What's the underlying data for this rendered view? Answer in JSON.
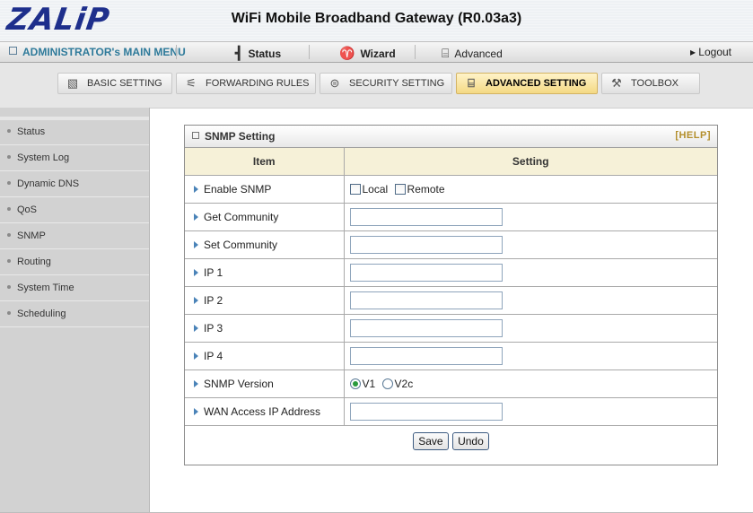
{
  "header": {
    "logo": "ZALiP",
    "title": "WiFi Mobile Broadband Gateway (R0.03a3)"
  },
  "menubar": {
    "admin_label": "ADMINISTRATOR's MAIN MENU",
    "status_label": "Status",
    "wizard_label": "Wizard",
    "advanced_label": "Advanced",
    "logout_label": "▸ Logout",
    "icons": {
      "status": "status-icon",
      "wizard": "wizard-icon",
      "advanced": "advanced-icon"
    }
  },
  "tabs": [
    {
      "label": "BASIC SETTING",
      "icon": "basic-setting-icon"
    },
    {
      "label": "FORWARDING RULES",
      "icon": "forwarding-rules-icon"
    },
    {
      "label": "SECURITY SETTING",
      "icon": "security-setting-icon"
    },
    {
      "label": "ADVANCED SETTING",
      "icon": "advanced-setting-icon",
      "active": true
    },
    {
      "label": "TOOLBOX",
      "icon": "toolbox-icon"
    }
  ],
  "sidebar": {
    "items": [
      {
        "label": "Status"
      },
      {
        "label": "System Log"
      },
      {
        "label": "Dynamic DNS"
      },
      {
        "label": "QoS"
      },
      {
        "label": "SNMP"
      },
      {
        "label": "Routing"
      },
      {
        "label": "System Time"
      },
      {
        "label": "Scheduling"
      }
    ]
  },
  "panel": {
    "title": "SNMP Setting",
    "help": "[HELP]",
    "col_item": "Item",
    "col_setting": "Setting",
    "rows": {
      "enable_snmp": {
        "label": "Enable SNMP",
        "local": "Local",
        "remote": "Remote",
        "local_checked": false,
        "remote_checked": false
      },
      "get_community": {
        "label": "Get Community",
        "value": ""
      },
      "set_community": {
        "label": "Set Community",
        "value": ""
      },
      "ip1": {
        "label": "IP 1",
        "value": ""
      },
      "ip2": {
        "label": "IP 2",
        "value": ""
      },
      "ip3": {
        "label": "IP 3",
        "value": ""
      },
      "ip4": {
        "label": "IP 4",
        "value": ""
      },
      "snmp_version": {
        "label": "SNMP Version",
        "v1": "V1",
        "v2c": "V2c",
        "selected": "V1"
      },
      "wan_access": {
        "label": "WAN Access IP Address",
        "value": ""
      }
    },
    "save_label": "Save",
    "undo_label": "Undo"
  },
  "colors": {
    "accent_blue": "#2e7a9a",
    "logo_blue": "#1e2f8c",
    "active_tab": "#f4d984",
    "header_row": "#f6f1d8",
    "help": "#b38e2b",
    "radio_on": "#2a9a3c"
  }
}
